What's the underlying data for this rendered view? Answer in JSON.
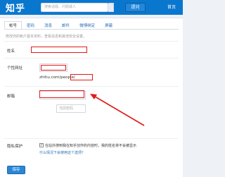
{
  "header": {
    "logo": "知乎",
    "search_placeholder": "搜索话题、问题或人",
    "ask_label": "提问",
    "home_label": "首页"
  },
  "tabs": [
    {
      "label": "帐号"
    },
    {
      "label": "密码"
    },
    {
      "label": "消息"
    },
    {
      "label": "邮件"
    },
    {
      "label": "微博绑定"
    },
    {
      "label": "屏蔽"
    }
  ],
  "hint": "修改你的帐户基本资料，查看信息和其他安全设置。",
  "form": {
    "name_label": "姓名",
    "url_label": "个性网址",
    "url_prefix": "zhihu.com/people/",
    "email_label": "邮箱",
    "email_pwd_placeholder": "当前密码",
    "privacy_label": "隐私保护",
    "privacy_check": "✓",
    "privacy_text": "在站外搜到我在知乎创作的内容时，我的姓名将不会被显示",
    "privacy_link": "什么情况下会使用这个选项？",
    "save_label": "保存"
  },
  "annotation_color": "#e01b1b",
  "accent": "#0a77cf"
}
